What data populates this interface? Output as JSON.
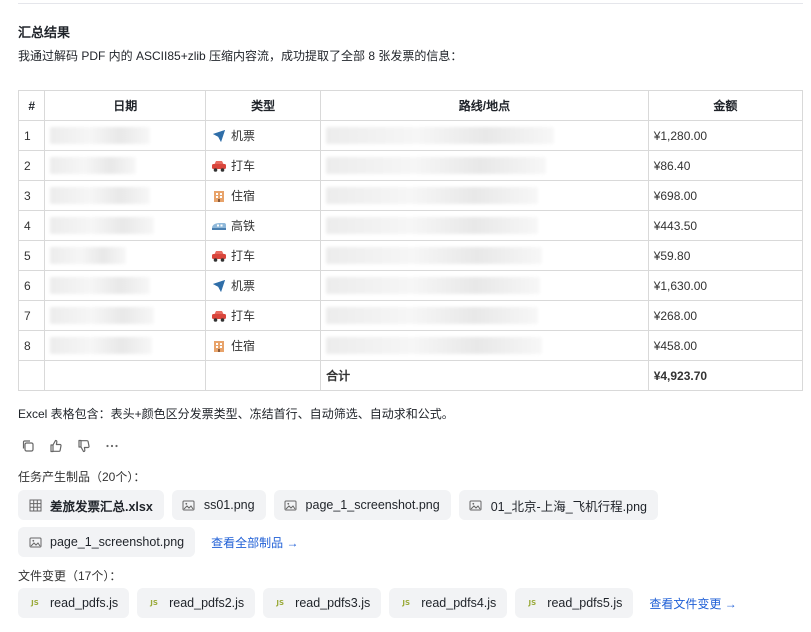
{
  "heading": "汇总结果",
  "intro": "我通过解码 PDF 内的 ASCII85+zlib 压缩内容流，成功提取了全部 8 张发票的信息：",
  "table": {
    "headers": [
      "#",
      "日期",
      "类型",
      "路线/地点",
      "金额"
    ],
    "rows": [
      {
        "no": "1",
        "type": "机票",
        "icon": "airplane-icon",
        "amount": "¥1,280.00"
      },
      {
        "no": "2",
        "type": "打车",
        "icon": "car-icon",
        "amount": "¥86.40"
      },
      {
        "no": "3",
        "type": "住宿",
        "icon": "hotel-icon",
        "amount": "¥698.00"
      },
      {
        "no": "4",
        "type": "高铁",
        "icon": "train-icon",
        "amount": "¥443.50"
      },
      {
        "no": "5",
        "type": "打车",
        "icon": "car-icon",
        "amount": "¥59.80"
      },
      {
        "no": "6",
        "type": "机票",
        "icon": "airplane-icon",
        "amount": "¥1,630.00"
      },
      {
        "no": "7",
        "type": "打车",
        "icon": "car-icon",
        "amount": "¥268.00"
      },
      {
        "no": "8",
        "type": "住宿",
        "icon": "hotel-icon",
        "amount": "¥458.00"
      }
    ],
    "total_label": "合计",
    "total_value": "¥4,923.70"
  },
  "note": "Excel 表格包含：表头+颜色区分发票类型、冻结首行、自动筛选、自动求和公式。",
  "artifacts": {
    "label": "任务产生制品（20个）：",
    "items": [
      {
        "name": "差旅发票汇总.xlsx",
        "icon": "spreadsheet-icon"
      },
      {
        "name": "ss01.png",
        "icon": "image-icon"
      },
      {
        "name": "page_1_screenshot.png",
        "icon": "image-icon"
      },
      {
        "name": "01_北京-上海_飞机行程.png",
        "icon": "image-icon"
      },
      {
        "name": "page_1_screenshot.png",
        "icon": "image-icon"
      }
    ],
    "view_all": "查看全部制品 →"
  },
  "files": {
    "label": "文件变更（17个）：",
    "items": [
      {
        "name": "read_pdfs.js",
        "icon": "js-file-icon"
      },
      {
        "name": "read_pdfs2.js",
        "icon": "js-file-icon"
      },
      {
        "name": "read_pdfs3.js",
        "icon": "js-file-icon"
      },
      {
        "name": "read_pdfs4.js",
        "icon": "js-file-icon"
      },
      {
        "name": "read_pdfs5.js",
        "icon": "js-file-icon"
      }
    ],
    "js_tag": "JS",
    "view_changes": "查看文件变更 →"
  }
}
